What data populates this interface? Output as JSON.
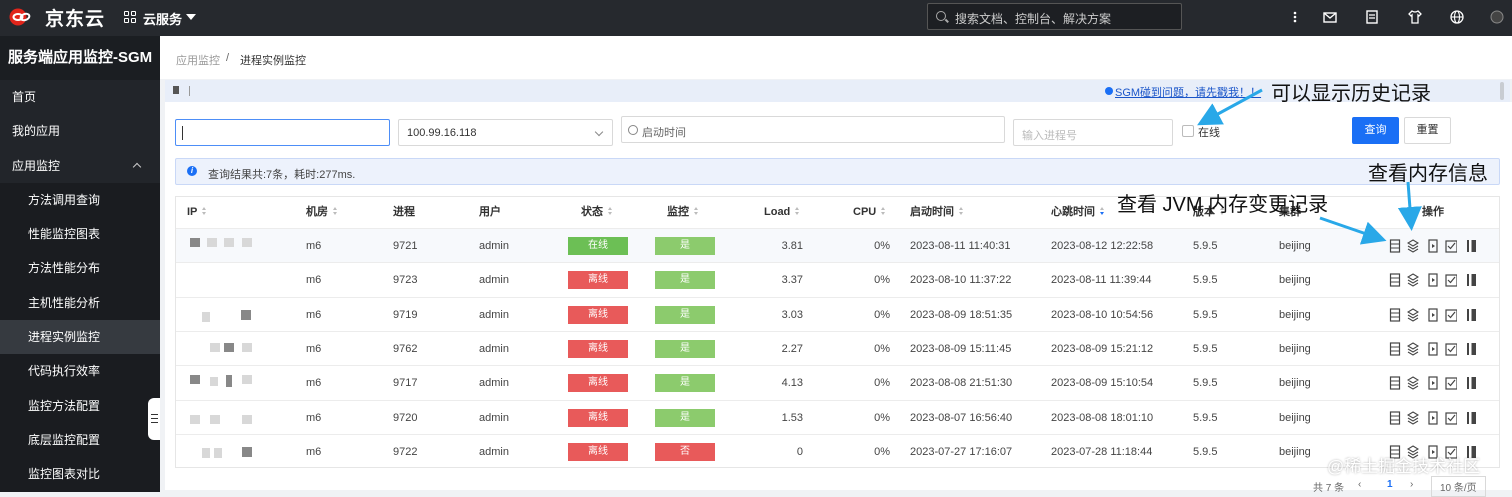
{
  "brand": {
    "name": "京东云",
    "logo_color": "#e1251b"
  },
  "topbar": {
    "service_menu": "云服务",
    "search_placeholder": "搜索文档、控制台、解决方案"
  },
  "sidebar": {
    "title": "服务端应用监控-SGM",
    "items": [
      {
        "label": "首页",
        "level": 1
      },
      {
        "label": "我的应用",
        "level": 1
      },
      {
        "label": "应用监控",
        "level": 1,
        "expanded": true
      },
      {
        "label": "方法调用查询",
        "level": 2
      },
      {
        "label": "性能监控图表",
        "level": 2
      },
      {
        "label": "方法性能分布",
        "level": 2
      },
      {
        "label": "主机性能分析",
        "level": 2
      },
      {
        "label": "进程实例监控",
        "level": 2,
        "active": true
      },
      {
        "label": "代码执行效率",
        "level": 2
      },
      {
        "label": "监控方法配置",
        "level": 2
      },
      {
        "label": "底层监控配置",
        "level": 2
      },
      {
        "label": "监控图表对比",
        "level": 2
      }
    ]
  },
  "breadcrumb": {
    "parent": "应用监控",
    "separator": "/",
    "current": "进程实例监控"
  },
  "notice": {
    "link": "SGM碰到问题，请先戳我！！"
  },
  "filters": {
    "ip_value": "",
    "ip_placeholder": "",
    "host_select": "100.99.16.118",
    "start_time_placeholder": "启动时间",
    "pid_placeholder": "输入进程号",
    "online_label": "在线",
    "online_checked": false,
    "query_button": "查询",
    "reset_button": "重置"
  },
  "info": {
    "text": "查询结果共:7条，耗时:277ms."
  },
  "table": {
    "headers": {
      "ip": "IP",
      "room": "机房",
      "process": "进程",
      "user": "用户",
      "status": "状态",
      "monitor": "监控",
      "load": "Load",
      "cpu": "CPU",
      "start_time": "启动时间",
      "heartbeat": "心跳时间",
      "version": "版本",
      "cluster": "集群",
      "actions": "操作"
    },
    "rows": [
      {
        "room": "m6",
        "process": "9721",
        "user": "admin",
        "status": "在线",
        "status_type": "on",
        "monitor": "是",
        "monitor_type": "yes",
        "load": "3.81",
        "cpu": "0%",
        "start_time": "2023-08-11 11:40:31",
        "heartbeat": "2023-08-12 12:22:58",
        "version": "5.9.5",
        "cluster": "beijing"
      },
      {
        "room": "m6",
        "process": "9723",
        "user": "admin",
        "status": "离线",
        "status_type": "off",
        "monitor": "是",
        "monitor_type": "yes",
        "load": "3.37",
        "cpu": "0%",
        "start_time": "2023-08-10 11:37:22",
        "heartbeat": "2023-08-11 11:39:44",
        "version": "5.9.5",
        "cluster": "beijing"
      },
      {
        "room": "m6",
        "process": "9719",
        "user": "admin",
        "status": "离线",
        "status_type": "off",
        "monitor": "是",
        "monitor_type": "yes",
        "load": "3.03",
        "cpu": "0%",
        "start_time": "2023-08-09 18:51:35",
        "heartbeat": "2023-08-10 10:54:56",
        "version": "5.9.5",
        "cluster": "beijing"
      },
      {
        "room": "m6",
        "process": "9762",
        "user": "admin",
        "status": "离线",
        "status_type": "off",
        "monitor": "是",
        "monitor_type": "yes",
        "load": "2.27",
        "cpu": "0%",
        "start_time": "2023-08-09 15:11:45",
        "heartbeat": "2023-08-09 15:21:12",
        "version": "5.9.5",
        "cluster": "beijing"
      },
      {
        "room": "m6",
        "process": "9717",
        "user": "admin",
        "status": "离线",
        "status_type": "off",
        "monitor": "是",
        "monitor_type": "yes",
        "load": "4.13",
        "cpu": "0%",
        "start_time": "2023-08-08 21:51:30",
        "heartbeat": "2023-08-09 15:10:54",
        "version": "5.9.5",
        "cluster": "beijing"
      },
      {
        "room": "m6",
        "process": "9720",
        "user": "admin",
        "status": "离线",
        "status_type": "off",
        "monitor": "是",
        "monitor_type": "yes",
        "load": "1.53",
        "cpu": "0%",
        "start_time": "2023-08-07 16:56:40",
        "heartbeat": "2023-08-08 18:01:10",
        "version": "5.9.5",
        "cluster": "beijing"
      },
      {
        "room": "m6",
        "process": "9722",
        "user": "admin",
        "status": "离线",
        "status_type": "off",
        "monitor": "否",
        "monitor_type": "no",
        "load": "0",
        "cpu": "0%",
        "start_time": "2023-07-27 17:16:07",
        "heartbeat": "2023-07-28 11:18:44",
        "version": "5.9.5",
        "cluster": "beijing"
      }
    ],
    "row_actions": [
      "server-icon",
      "layers-icon",
      "play-file-icon",
      "check-box-icon",
      "bookmark-icon"
    ]
  },
  "annotations": {
    "history": "可以显示历史记录",
    "memory_info": "查看内存信息",
    "jvm_memory": "查看 JVM 内存变更记录",
    "arrow_color": "#29a8e8"
  },
  "pagination": {
    "total": "共 7 条",
    "current_page": "1",
    "page_size": "10 条/页"
  },
  "watermark": "@稀土掘金技术社区",
  "colors": {
    "primary": "#1a6ff5",
    "online": "#6cbf55",
    "offline": "#e85a5a",
    "yes": "#8ccb6d"
  }
}
